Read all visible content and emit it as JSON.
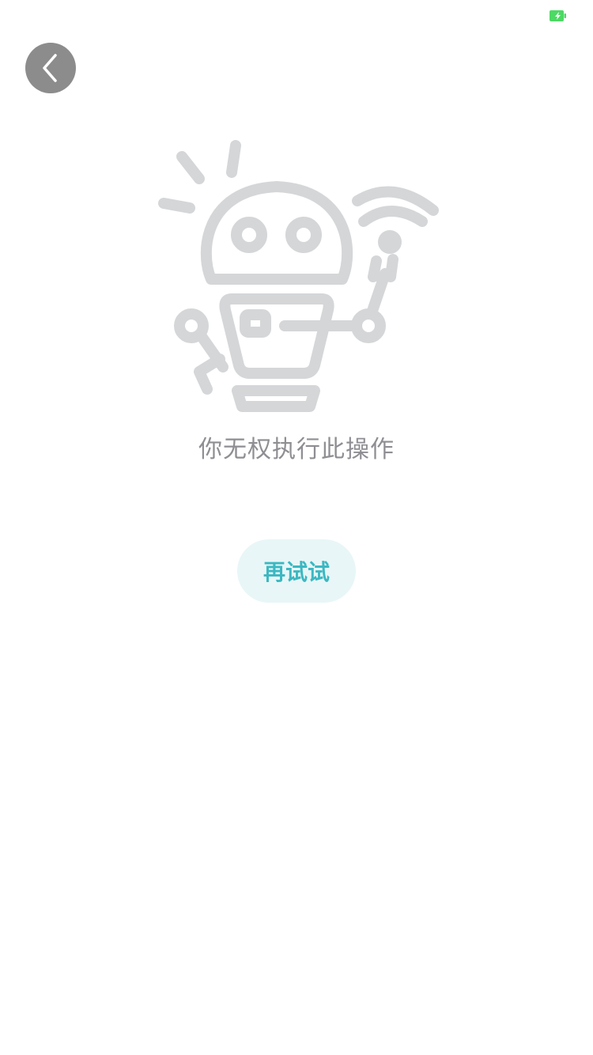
{
  "status_bar": {
    "battery_icon": "battery-charging-icon",
    "battery_color": "#4cd964"
  },
  "nav": {
    "back_icon": "chevron-left-icon",
    "back_bg_color": "#8c8c8c"
  },
  "empty_state": {
    "illustration": "robot-icon",
    "illustration_color": "#d4d6d8",
    "message": "你无权执行此操作",
    "message_color": "#8e8e93"
  },
  "actions": {
    "retry_label": "再试试",
    "retry_text_color": "#3bb8c2",
    "retry_bg_color": "#e8f6f7"
  }
}
